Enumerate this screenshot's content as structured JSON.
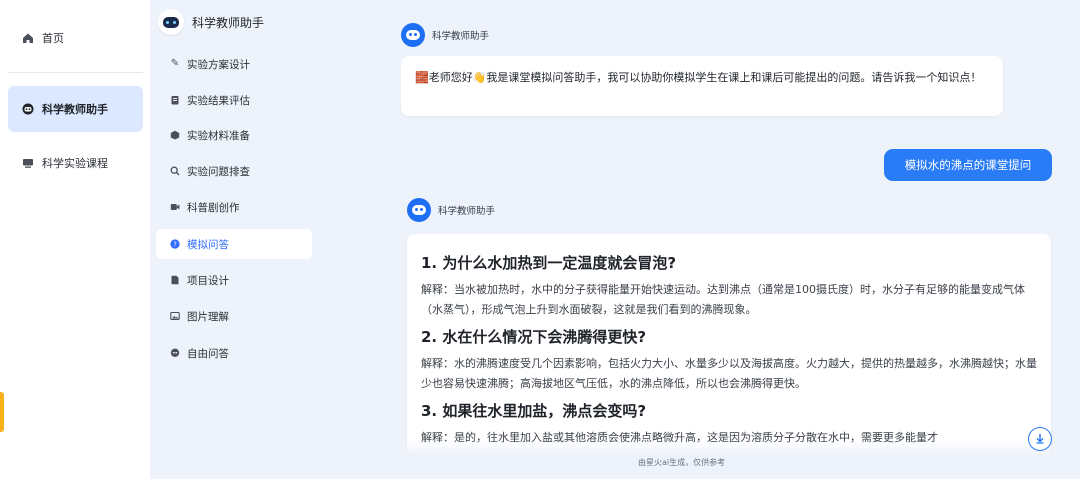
{
  "nav": {
    "items": [
      {
        "label": "首页",
        "icon": "home-icon"
      },
      {
        "label": "科学教师助手",
        "icon": "robot-icon"
      },
      {
        "label": "科学实验课程",
        "icon": "monitor-icon"
      }
    ]
  },
  "sub": {
    "title": "科学教师助手",
    "items": [
      {
        "label": "实验方案设计",
        "icon": "pencil-icon"
      },
      {
        "label": "实验结果评估",
        "icon": "clipboard-icon"
      },
      {
        "label": "实验材料准备",
        "icon": "box-icon"
      },
      {
        "label": "实验问题排查",
        "icon": "search-icon"
      },
      {
        "label": "科普剧创作",
        "icon": "film-icon"
      },
      {
        "label": "模拟问答",
        "icon": "question-icon"
      },
      {
        "label": "项目设计",
        "icon": "document-icon"
      },
      {
        "label": "图片理解",
        "icon": "image-icon"
      },
      {
        "label": "自由问答",
        "icon": "chat-icon"
      }
    ]
  },
  "chat": {
    "assistant_name": "科学教师助手",
    "greeting": "🧱老师您好👋我是课堂模拟问答助手，我可以协助你模拟学生在课上和课后可能提出的问题。请告诉我一个知识点！",
    "user_message": "模拟水的沸点的课堂提问",
    "answers": [
      {
        "q": "1. 为什么水加热到一定温度就会冒泡?",
        "a": "解释：当水被加热时，水中的分子获得能量开始快速运动。达到沸点（通常是100摄氏度）时，水分子有足够的能量变成气体（水蒸气），形成气泡上升到水面破裂，这就是我们看到的沸腾现象。"
      },
      {
        "q": "2. 水在什么情况下会沸腾得更快?",
        "a": "解释：水的沸腾速度受几个因素影响，包括火力大小、水量多少以及海拔高度。火力越大，提供的热量越多，水沸腾越快；水量少也容易快速沸腾；高海拔地区气压低，水的沸点降低，所以也会沸腾得更快。"
      },
      {
        "q": "3. 如果往水里加盐，沸点会变吗?",
        "a": "解释：是的，往水里加入盐或其他溶质会使沸点略微升高，这是因为溶质分子分散在水中，需要更多能量才"
      }
    ],
    "footer_note": "由星火ai生成，仅供参考",
    "scroll_down_icon": "arrow-down-icon"
  },
  "colors": {
    "accent": "#2a7bf6",
    "active_nav_bg": "#dce8ff",
    "side_accent": "#f5b21b"
  }
}
